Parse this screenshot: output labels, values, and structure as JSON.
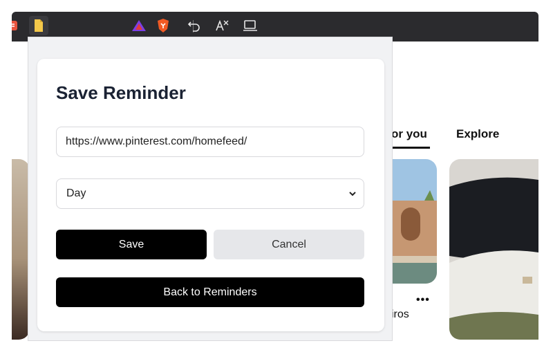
{
  "toolbar": {
    "icons": [
      "bookmarks-extension-icon",
      "notes-extension-icon",
      "triangle-extension-icon",
      "brave-shields-icon",
      "undo-icon",
      "translate-icon",
      "cast-icon"
    ]
  },
  "feed": {
    "tabs": [
      {
        "label": "or you",
        "active": true
      },
      {
        "label": "Explore",
        "active": false
      }
    ],
    "pin_caption": "iros",
    "more_label": "•••"
  },
  "popup": {
    "title": "Save Reminder",
    "url_value": "https://www.pinterest.com/homefeed/",
    "frequency_selected": "Day",
    "save_label": "Save",
    "cancel_label": "Cancel",
    "back_label": "Back to Reminders"
  },
  "colors": {
    "primary_button": "#000000",
    "secondary_button": "#e6e7ea",
    "title_text": "#1a2233",
    "toolbar_bg": "#2b2b2e"
  }
}
